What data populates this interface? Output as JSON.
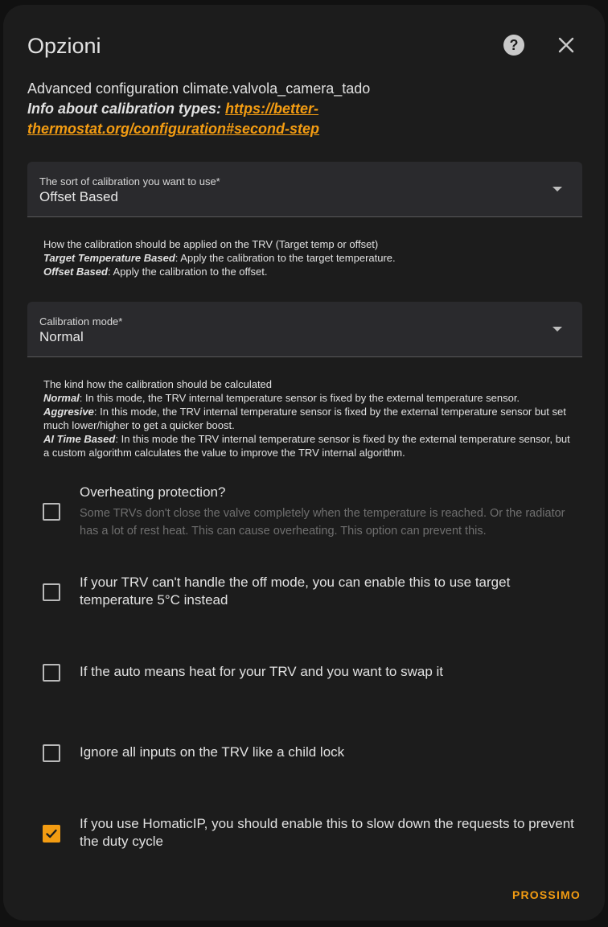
{
  "dialog": {
    "title": "Opzioni",
    "description_line": "Advanced configuration climate.valvola_camera_tado",
    "info_label": "Info about calibration types:",
    "info_link": "https://better-thermostat.org/configuration#second-step",
    "help_icon": "help-circle-icon",
    "close_icon": "close-icon",
    "next_label": "PROSSIMO",
    "accent_color": "#f39c12"
  },
  "calibration_type": {
    "label": "The sort of calibration you want to use*",
    "value": "Offset Based",
    "help_intro": "How the calibration should be applied on the TRV (Target temp or offset)",
    "help_items": [
      {
        "term": "Target Temperature Based",
        "text": ": Apply the calibration to the target temperature."
      },
      {
        "term": "Offset Based",
        "text": ": Apply the calibration to the offset."
      }
    ]
  },
  "calibration_mode": {
    "label": "Calibration mode*",
    "value": "Normal",
    "help_intro": "The kind how the calibration should be calculated",
    "help_items": [
      {
        "term": "Normal",
        "text": ": In this mode, the TRV internal temperature sensor is fixed by the external temperature sensor."
      },
      {
        "term": "Aggresive",
        "text": ": In this mode, the TRV internal temperature sensor is fixed by the external temperature sensor but set much lower/higher to get a quicker boost."
      },
      {
        "term": "AI Time Based",
        "text": ": In this mode the TRV internal temperature sensor is fixed by the external temperature sensor, but a custom algorithm calculates the value to improve the TRV internal algorithm."
      }
    ]
  },
  "options": [
    {
      "label": "Overheating protection?",
      "sub": "Some TRVs don't close the valve completely when the temperature is reached. Or the radiator has a lot of rest heat. This can cause overheating. This option can prevent this.",
      "checked": false
    },
    {
      "label": "If your TRV can't handle the off mode, you can enable this to use target temperature 5°C instead",
      "checked": false
    },
    {
      "label": "If the auto means heat for your TRV and you want to swap it",
      "checked": false
    },
    {
      "label": "Ignore all inputs on the TRV like a child lock",
      "checked": false
    },
    {
      "label": "If you use HomaticIP, you should enable this to slow down the requests to prevent the duty cycle",
      "checked": true
    }
  ]
}
